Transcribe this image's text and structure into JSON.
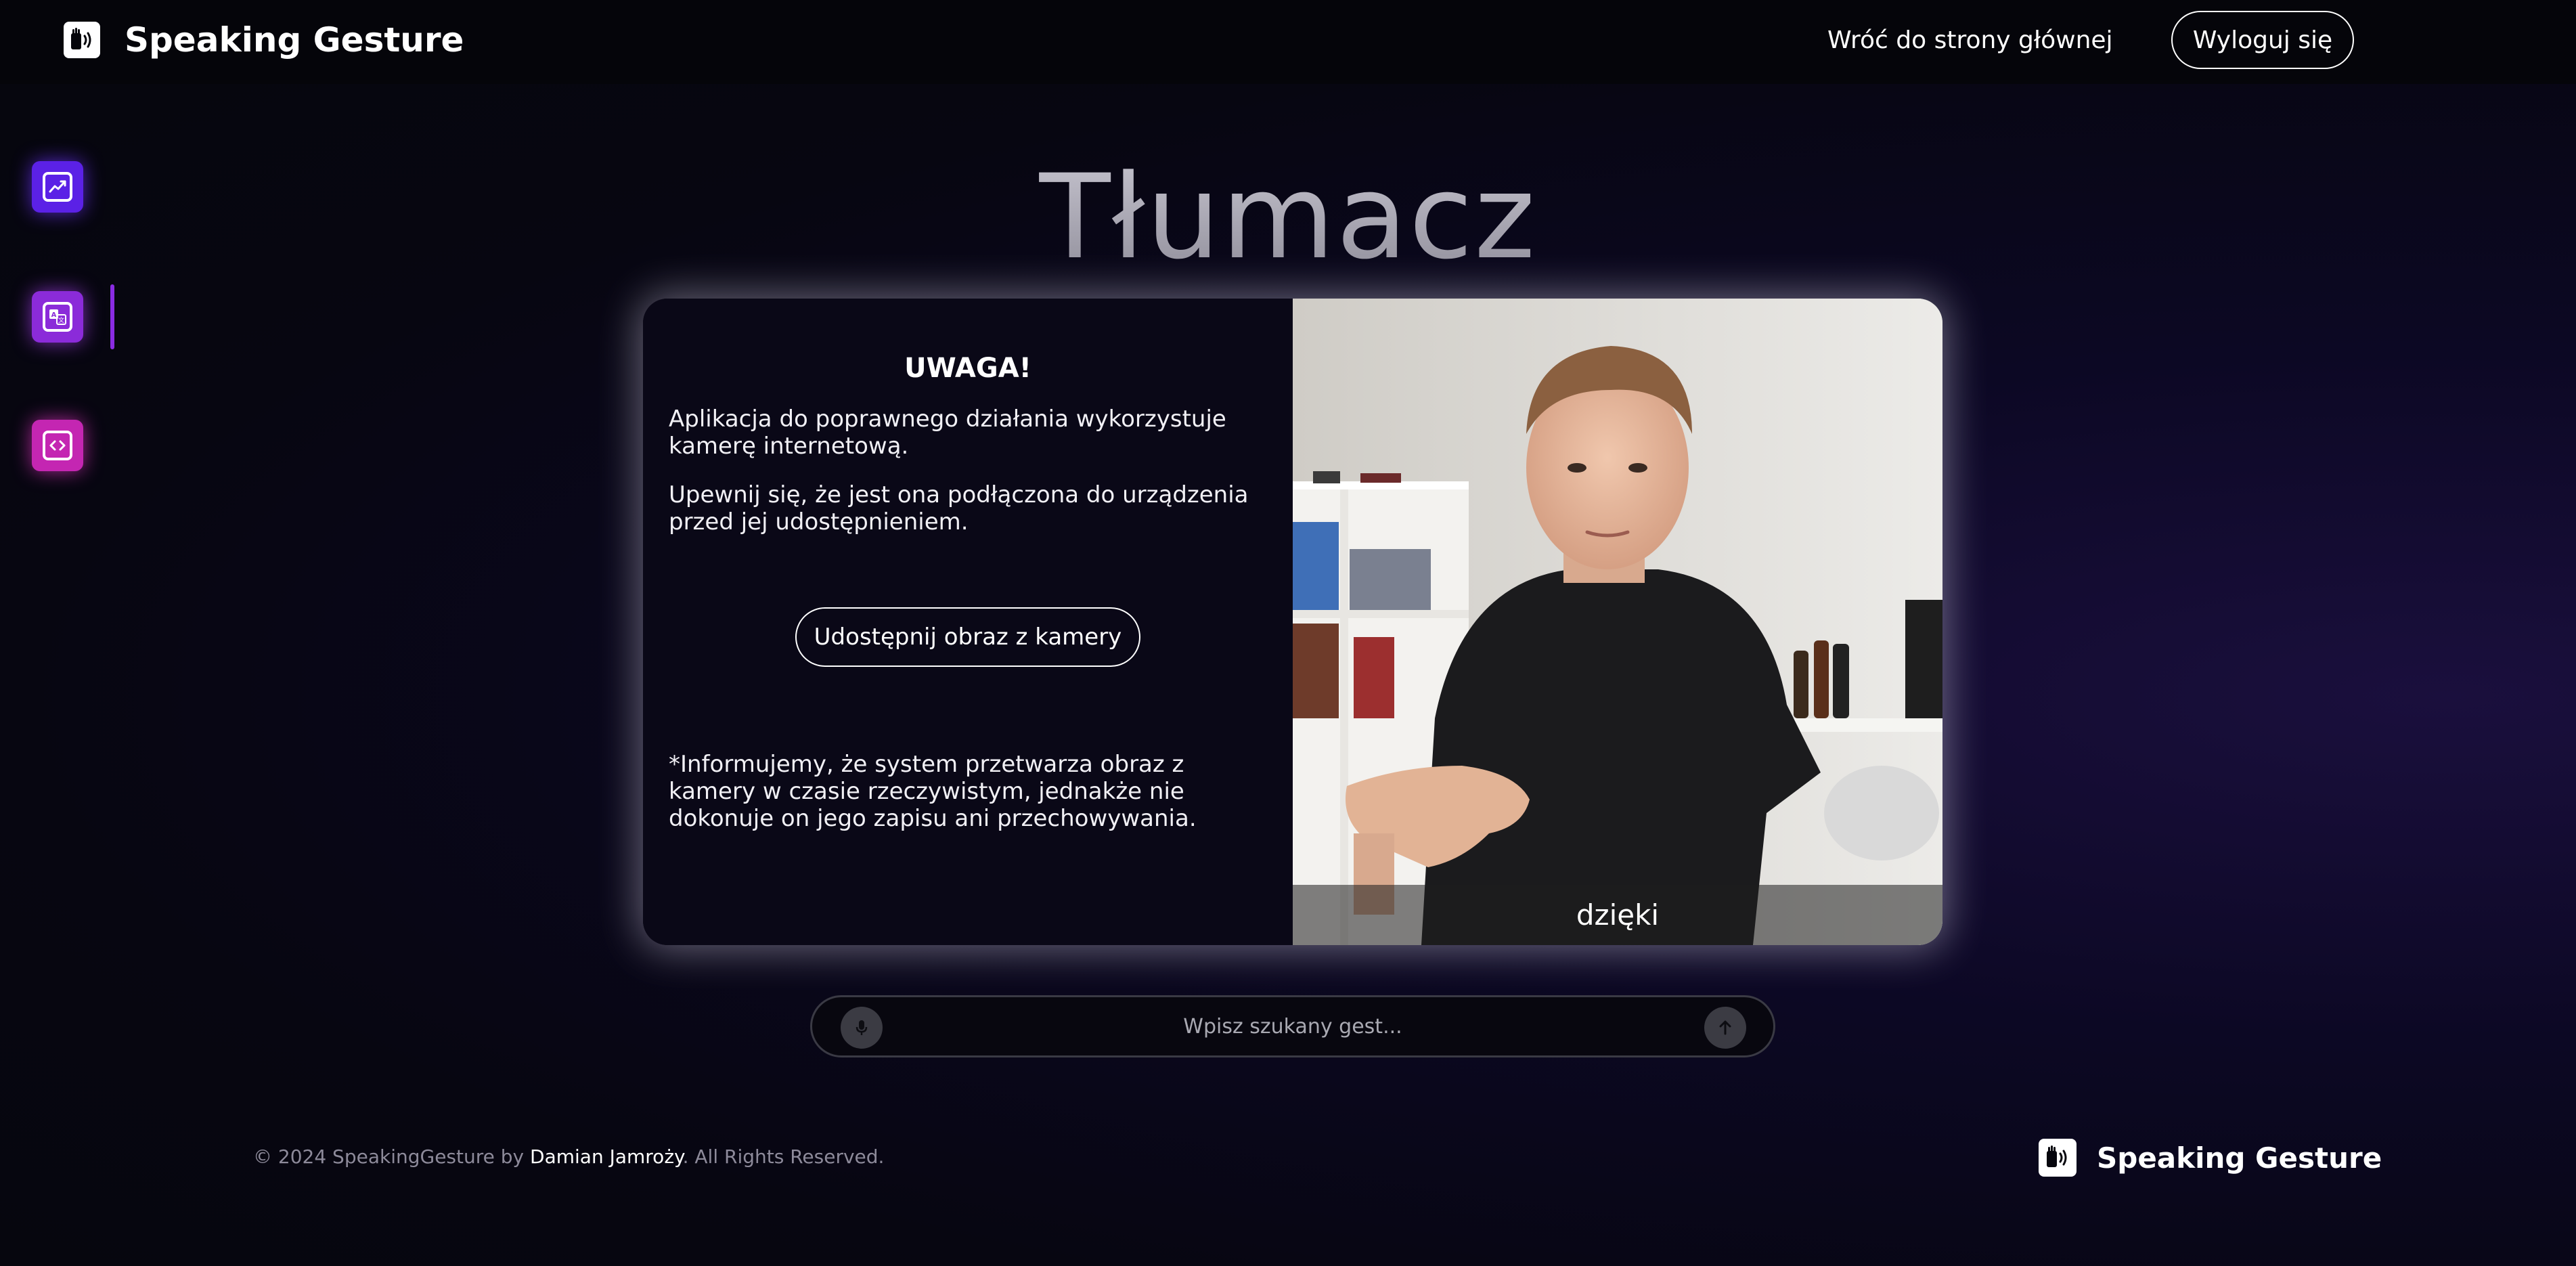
{
  "brand": {
    "name": "Speaking Gesture",
    "icon": "sign-language-speaking-hand-icon"
  },
  "nav": {
    "home_link": "Wróć do strony głównej",
    "logout": "Wyloguj się"
  },
  "sidebar": {
    "items": [
      {
        "icon": "chart-icon",
        "color": "#5b21e6",
        "active": false
      },
      {
        "icon": "translate-icon",
        "color": "#8b2bd9",
        "active": true
      },
      {
        "icon": "code-icon",
        "color": "#c426b2",
        "active": false
      }
    ]
  },
  "page": {
    "title": "Tłumacz"
  },
  "notice": {
    "title": "UWAGA!",
    "p1": "Aplikacja do poprawnego działania wykorzystuje kamerę internetową.",
    "p2": "Upewnij się, że jest ona podłączona do urządzenia przed jej udostępnieniem.",
    "button": "Udostępnij obraz z kamery",
    "disclaimer": "*Informujemy, że system przetwarza obraz z kamery w czasie rzeczywistym, jednakże nie dokonuje on jego zapisu ani przechowywania."
  },
  "camera": {
    "caption": "dzięki"
  },
  "search": {
    "placeholder": "Wpisz szukany gest...",
    "mic_icon": "microphone-icon",
    "send_icon": "arrow-up-icon"
  },
  "footer": {
    "copy_prefix": "© 2024 SpeakingGesture by ",
    "author": "Damian Jamroży",
    "copy_suffix": ". All Rights Reserved.",
    "brand_name": "Speaking Gesture"
  },
  "colors": {
    "accent_purple": "#8a2be2",
    "background": "#06060d"
  }
}
